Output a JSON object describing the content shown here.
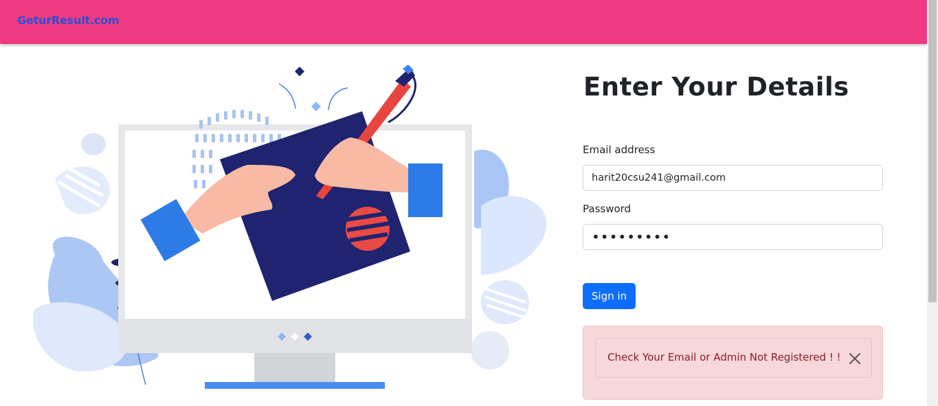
{
  "navbar": {
    "brand": "GeturResult.com",
    "color": "#ee3a80",
    "brand_color": "#2c50d6"
  },
  "form": {
    "title": "Enter Your Details",
    "email_label": "Email address",
    "email_value": "harit20csu241@gmail.com",
    "password_label": "Password",
    "password_value": "•••••••••",
    "submit_label": "Sign in",
    "submit_color": "#0d6efd"
  },
  "alert": {
    "message": "Check Your Email or Admin Not Registered ! !",
    "close_icon": "close-icon",
    "text_color": "#842029",
    "background": "#f8d7da"
  },
  "illustration": {
    "icon": "computer-drawing-illustration"
  }
}
